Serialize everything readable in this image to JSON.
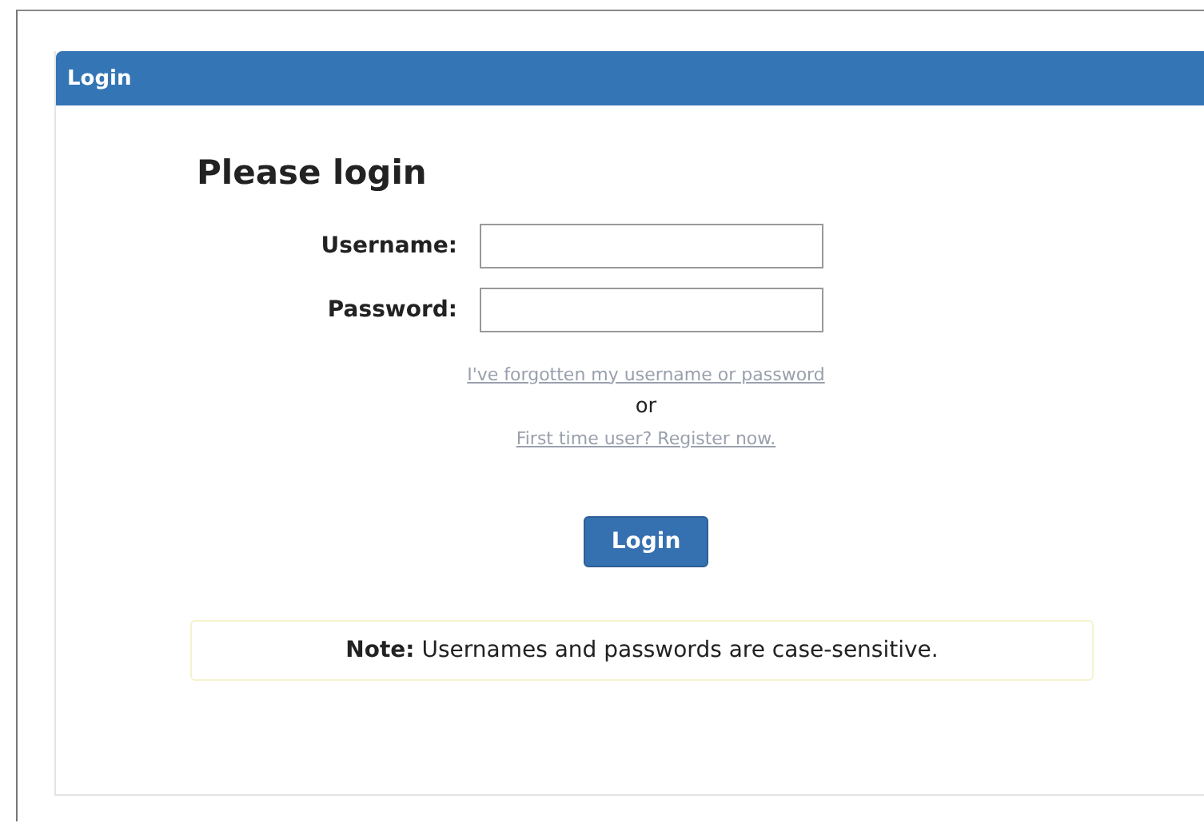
{
  "panel": {
    "title": "Login"
  },
  "heading": "Please login",
  "fields": [
    {
      "label": "Username:"
    },
    {
      "label": "Password:"
    }
  ],
  "links": [
    {
      "kind": "link",
      "text": "I've forgotten my username or password"
    },
    {
      "kind": "text",
      "text": "or"
    },
    {
      "kind": "link",
      "text": "First time user? Register now."
    }
  ],
  "button": "Login",
  "note": "**Note:** Usernames and passwords are case-sensitive."
}
